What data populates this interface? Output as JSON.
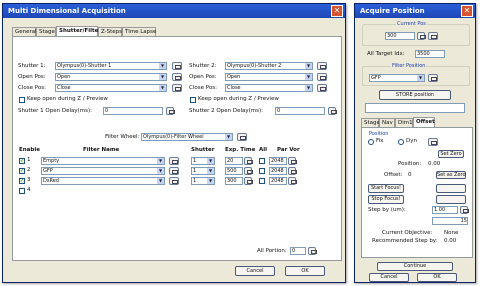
{
  "left_window": {
    "title": "Multi Dimensional Acquisition",
    "tabs": [
      "General",
      "Stage",
      "Shutter/Filters",
      "Z-Steps",
      "Time Lapse"
    ],
    "shutter1": {
      "label": "Shutter 1:",
      "value": "Olympus(0)-Shutter 1"
    },
    "shutter2": {
      "label": "Shutter 2:",
      "value": "Olympus(0)-Shutter 2"
    },
    "open_pos": {
      "label": "Open Pos:",
      "value1": "Open",
      "value2": "Open"
    },
    "close_pos": {
      "label": "Close Pos:",
      "value1": "Close",
      "value2": "Close"
    },
    "keep_open1": "Keep open during Z / Preview",
    "keep_open2": "Keep open during Z / Preview",
    "shutter1_delay": {
      "label": "Shutter 1 Open Delay(ms):",
      "value": "0"
    },
    "shutter2_delay": {
      "label": "Shutter 2 Open Delay(ms):",
      "value": "0"
    },
    "filter_wheel": {
      "label": "Filter Wheel:",
      "value": "Olympus(0)-Filter Wheel"
    },
    "columns": [
      "Enable",
      "Filter Name",
      "Shutter",
      "Exp. Time",
      "All",
      "Par Vor"
    ],
    "rows": [
      {
        "enable": "1",
        "filter": "Empty",
        "shutter": "1",
        "exp": "20",
        "all": "2048",
        "checked": true
      },
      {
        "enable": "2",
        "filter": "GFP",
        "shutter": "1",
        "exp": "500",
        "all": "2048",
        "checked": true
      },
      {
        "enable": "3",
        "filter": "DsRed",
        "shutter": "1",
        "exp": "300",
        "all": "2048",
        "checked": true
      },
      {
        "enable": "4",
        "filter": "",
        "shutter": "",
        "exp": "",
        "all": "",
        "checked": false
      }
    ],
    "all_portion": {
      "label": "All Portion:",
      "value": "0"
    },
    "cancel": "Cancel",
    "ok": "OK"
  },
  "right_window": {
    "title": "Acquire Position",
    "cur_pos_label": "Current Pos",
    "cur_pos_value": "300",
    "all_target_label": "All Target Idx:",
    "all_target_value": "3500",
    "filter_position_label": "Filter Position",
    "filter_position_value": "GFP",
    "store_btn": "STORE position",
    "tabs": [
      "Stage",
      "Nav",
      "Dim1",
      "Offset"
    ],
    "section_label": "Position",
    "radio1": "Fix",
    "radio2": "Dyn",
    "set_zero": "Set Zero",
    "position_label": "Position:",
    "position_value": "0.00",
    "offset_label": "Offset:",
    "offset_value": "0",
    "set_as_zero": "Set as Zero",
    "start_focus": "Start Focus!",
    "stop_focus": "Stop Focus!",
    "step_label": "Step by (um):",
    "step_value": "1.00",
    "steps_value": "15",
    "current_obj_label": "Current Objective:",
    "current_obj_value": "None",
    "recommended_label": "Recommended Step by:",
    "recommended_value": "0.00",
    "continue": "Continue",
    "cancel": "Cancel",
    "ok": "OK"
  }
}
